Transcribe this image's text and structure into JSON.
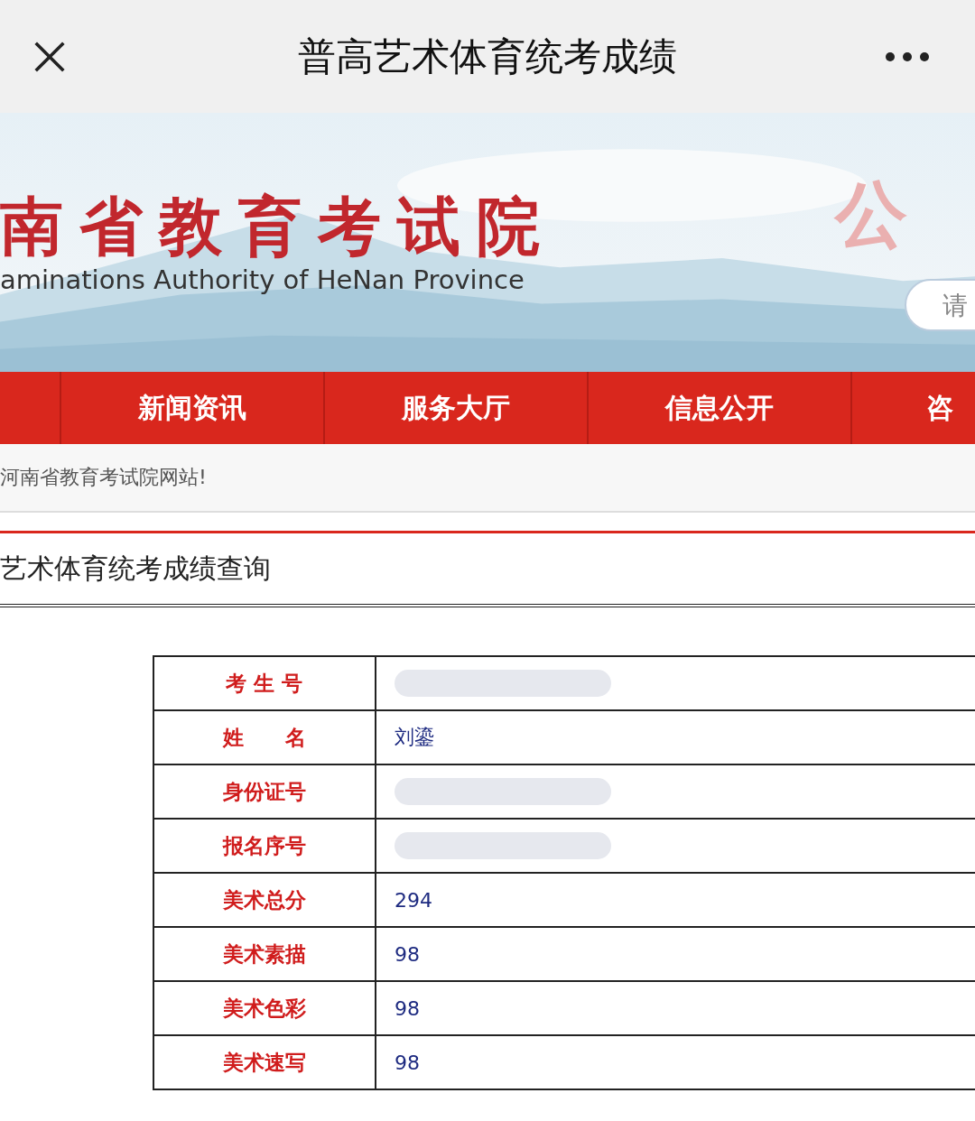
{
  "window": {
    "title": "普高艺术体育统考成绩"
  },
  "banner": {
    "title": "南省教育考试院",
    "subtitle": "aminations Authority of HeNan Province",
    "slogan": "公",
    "search": {
      "placeholder": "请"
    }
  },
  "nav": {
    "items": [
      {
        "label": "新闻资讯"
      },
      {
        "label": "服务大厅"
      },
      {
        "label": "信息公开"
      },
      {
        "label": "咨"
      }
    ]
  },
  "notice": "河南省教育考试院网站!",
  "heading": "艺术体育统考成绩查询",
  "table": {
    "rows": [
      {
        "label": "考 生 号",
        "redacted": true
      },
      {
        "label": "姓　　名",
        "value": "刘鎏",
        "redacted": false
      },
      {
        "label": "身份证号",
        "redacted": true
      },
      {
        "label": "报名序号",
        "redacted": true
      },
      {
        "label": "美术总分",
        "value": "294",
        "redacted": false
      },
      {
        "label": "美术素描",
        "value": "98",
        "redacted": false
      },
      {
        "label": "美术色彩",
        "value": "98",
        "redacted": false
      },
      {
        "label": "美术速写",
        "value": "98",
        "redacted": false
      }
    ]
  }
}
